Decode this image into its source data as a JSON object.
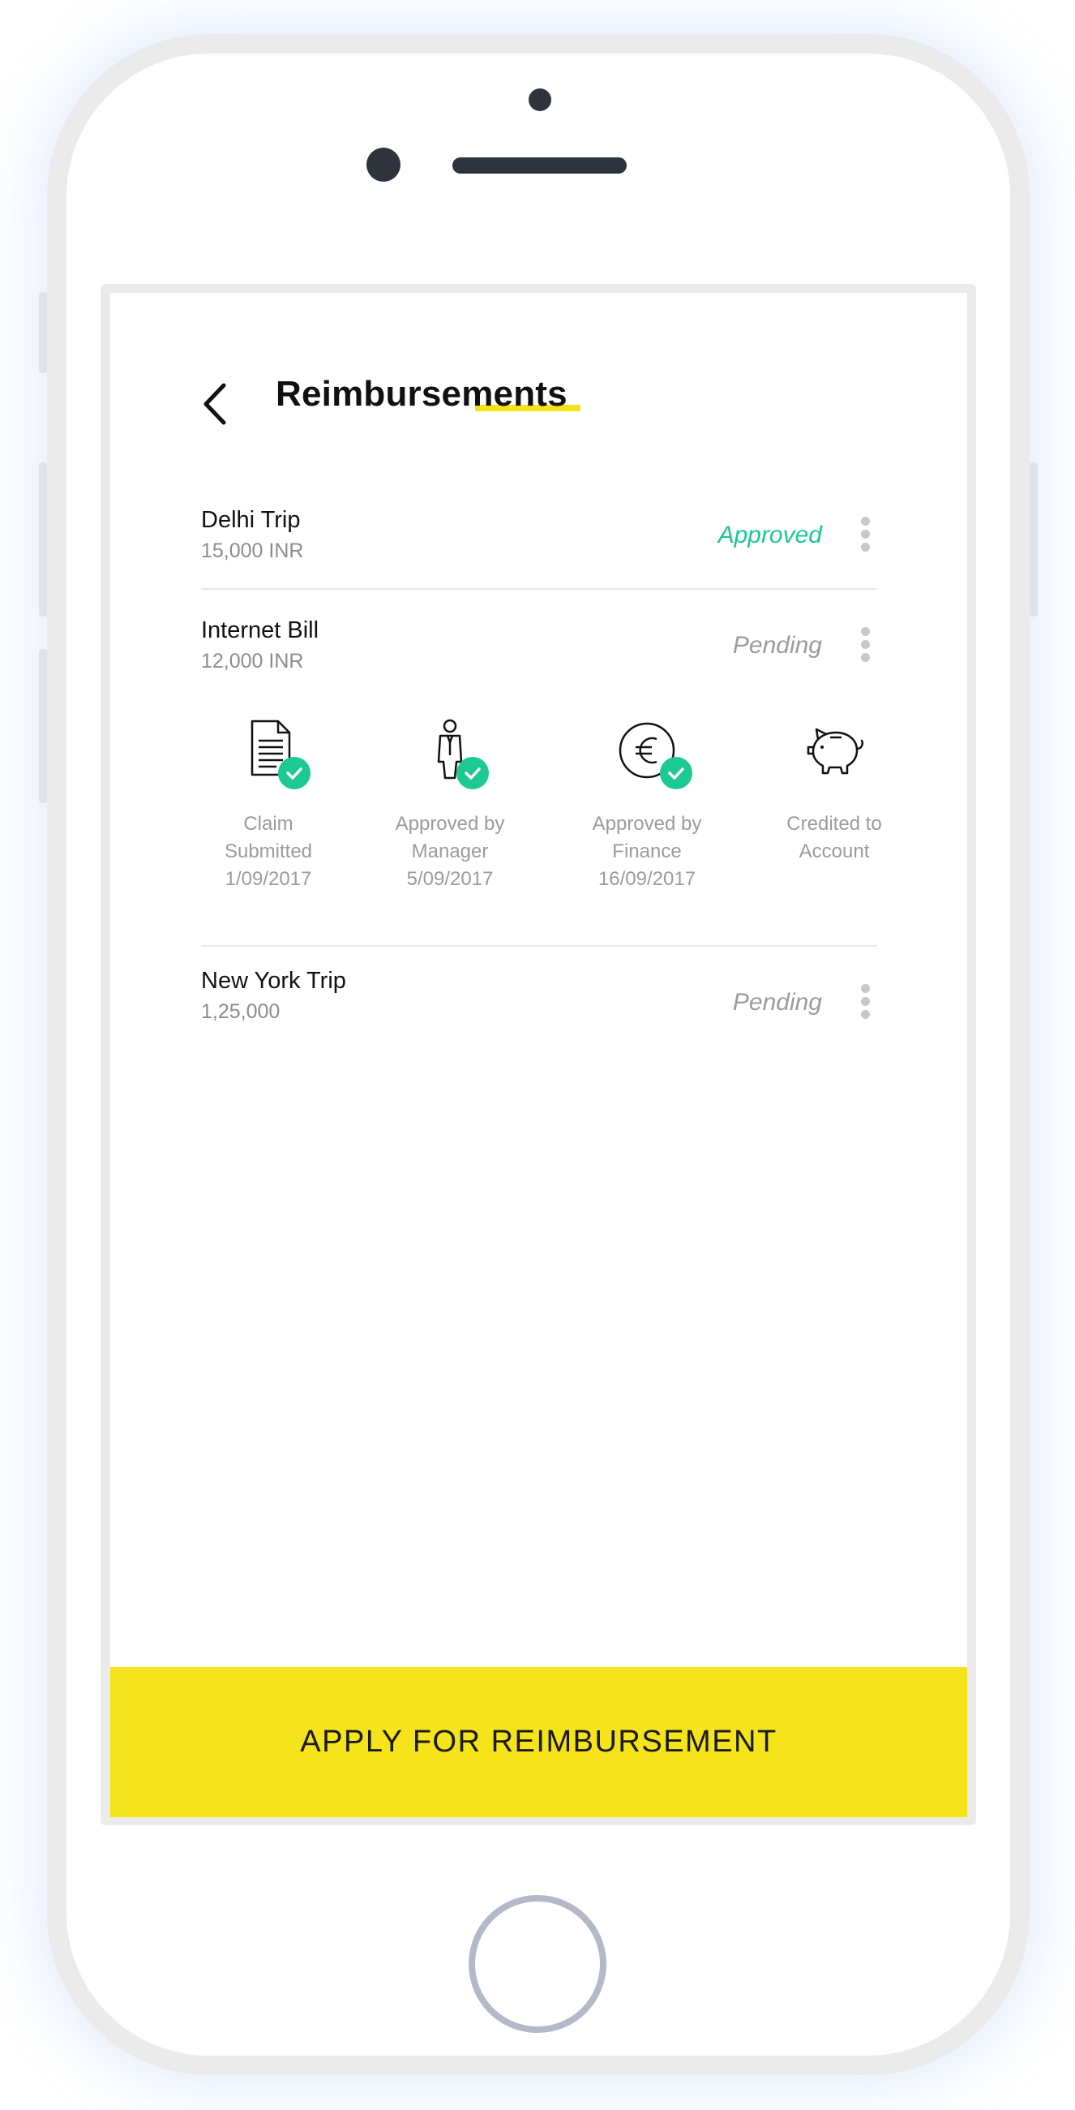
{
  "header": {
    "title": "Reimbursements",
    "back_icon": "chevron-left-icon"
  },
  "reimbursements": [
    {
      "name": "Delhi Trip",
      "amount": "15,000 INR",
      "status": "Approved",
      "status_color": "#1cc993"
    },
    {
      "name": "Internet Bill",
      "amount": "12,000 INR",
      "status": "Pending",
      "status_color": "#9b9b9b",
      "timeline": [
        {
          "icon": "document-icon",
          "lines": [
            "Claim",
            "Submitted",
            "1/09/2017"
          ],
          "completed": true
        },
        {
          "icon": "manager-icon",
          "lines": [
            "Approved by",
            "Manager",
            "5/09/2017"
          ],
          "completed": true
        },
        {
          "icon": "euro-coin-icon",
          "lines": [
            "Approved by",
            "Finance",
            "16/09/2017"
          ],
          "completed": true
        },
        {
          "icon": "piggy-bank-icon",
          "lines": [
            "Credited to",
            "Account"
          ],
          "completed": false
        }
      ]
    },
    {
      "name": "New York Trip",
      "amount": "1,25,000",
      "status": "Pending",
      "status_color": "#9b9b9b"
    }
  ],
  "cta": {
    "label": "APPLY FOR REIMBURSEMENT",
    "color": "#f5e31c"
  },
  "theme": {
    "accent": "#f3e31b",
    "success": "#1cc993",
    "muted": "#9b9b9b"
  }
}
